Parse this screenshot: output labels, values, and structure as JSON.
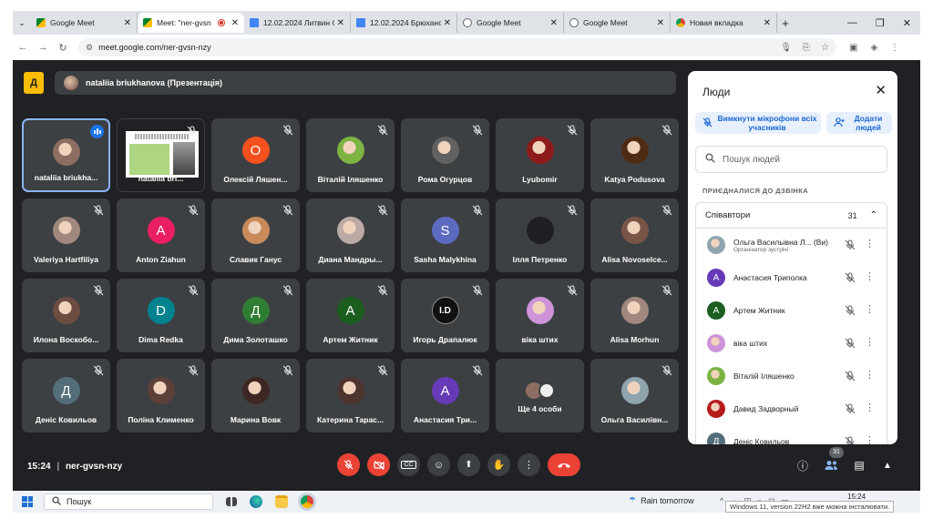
{
  "browser": {
    "tabs": [
      {
        "title": "Google Meet",
        "active": false,
        "icon": "meet-icon"
      },
      {
        "title": "Meet: \"ner-gvsn",
        "active": true,
        "icon": "meet-icon",
        "recording": true
      },
      {
        "title": "12.02.2024 Литвин С",
        "active": false,
        "icon": "docs-icon"
      },
      {
        "title": "12.02.2024 Брюханс",
        "active": false,
        "icon": "docs-icon"
      },
      {
        "title": "Google Meet",
        "active": false,
        "icon": "globe-icon"
      },
      {
        "title": "Google Meet",
        "active": false,
        "icon": "globe-icon"
      },
      {
        "title": "Новая вкладка",
        "active": false,
        "icon": "chrome-icon"
      }
    ],
    "url": "meet.google.com/ner-gvsn-nzy"
  },
  "meet": {
    "presenter_badge": "Д",
    "presenting_label": "nataliia briukhanova (Презентація)",
    "tiles": [
      {
        "name": "nataliia briukha...",
        "kind": "photo",
        "color": "#8d6e63",
        "speaking": true
      },
      {
        "name": "nataliia bri...",
        "kind": "slide"
      },
      {
        "name": "Олексій Ляшен...",
        "kind": "letter",
        "letter": "О",
        "color": "#f4511e"
      },
      {
        "name": "Віталій Іляшенко",
        "kind": "photo",
        "color": "#7cb342"
      },
      {
        "name": "Рома Огурцов",
        "kind": "photo",
        "color": "#616161"
      },
      {
        "name": "Lyubomir",
        "kind": "photo",
        "color": "#8e1b1b"
      },
      {
        "name": "Katya Podusova",
        "kind": "photo",
        "color": "#4e2c14"
      },
      {
        "name": "Valeriya Hartfiliya",
        "kind": "photo",
        "color": "#a1887f"
      },
      {
        "name": "Anton Ziahun",
        "kind": "letter",
        "letter": "A",
        "color": "#e91e63"
      },
      {
        "name": "Славик Ганус",
        "kind": "photo",
        "color": "#c98a5a"
      },
      {
        "name": "Диана Мандры...",
        "kind": "photo",
        "color": "#bcaaa4"
      },
      {
        "name": "Sasha Malykhina",
        "kind": "letter",
        "letter": "S",
        "color": "#5c6bc0"
      },
      {
        "name": "Ілля Петренко",
        "kind": "letter",
        "letter": "",
        "color": "#1e1f22"
      },
      {
        "name": "Alisa Novoselce...",
        "kind": "photo",
        "color": "#795548"
      },
      {
        "name": "Илона Воскобо...",
        "kind": "photo",
        "color": "#6d4c41"
      },
      {
        "name": "Dima Redka",
        "kind": "letter",
        "letter": "D",
        "color": "#00838f"
      },
      {
        "name": "Дима Золоташко",
        "kind": "letter",
        "letter": "Д",
        "color": "#2e7d32"
      },
      {
        "name": "Артем Житник",
        "kind": "letter",
        "letter": "A",
        "color": "#1b5e20"
      },
      {
        "name": "Игорь Драпалюк",
        "kind": "letter",
        "letter": "I.D",
        "color": "#111111"
      },
      {
        "name": "віка штих",
        "kind": "photo",
        "color": "#ce93d8"
      },
      {
        "name": "Alisa Morhun",
        "kind": "photo",
        "color": "#a1887f"
      },
      {
        "name": "Деніс Ковильов",
        "kind": "letter",
        "letter": "Д",
        "color": "#546e7a"
      },
      {
        "name": "Поліна Клименко",
        "kind": "photo",
        "color": "#5d4037"
      },
      {
        "name": "Марина Вовк",
        "kind": "photo",
        "color": "#3e2723"
      },
      {
        "name": "Катерина Тарас...",
        "kind": "photo",
        "color": "#4e342e"
      },
      {
        "name": "Анастасия Три...",
        "kind": "letter",
        "letter": "A",
        "color": "#673ab7"
      },
      {
        "name": "Ще 4 особи",
        "kind": "group"
      },
      {
        "name": "Ольга Василівн...",
        "kind": "photo",
        "color": "#90a4ae"
      }
    ],
    "time": "15:24",
    "meeting_code": "ner-gvsn-nzy",
    "people_count": "31"
  },
  "panel": {
    "title": "Люди",
    "mute_all_label": "Вимкнути мікрофони всіх учасників",
    "add_people_label": "Додати людей",
    "search_placeholder": "Пошук людей",
    "section_label": "ПРИЄДНАЛИСЯ ДО ДЗВІНКА",
    "group_label": "Співавтори",
    "group_count": "31",
    "participants": [
      {
        "name": "Ольга Васильівна Л... (Ви)",
        "sub": "Організатор зустрічі",
        "color": "#90a4ae",
        "letter": ""
      },
      {
        "name": "Анастасия Триполка",
        "sub": "",
        "color": "#673ab7",
        "letter": "A"
      },
      {
        "name": "Артем Житник",
        "sub": "",
        "color": "#1b5e20",
        "letter": "A"
      },
      {
        "name": "віка штих",
        "sub": "",
        "color": "#ce93d8",
        "letter": ""
      },
      {
        "name": "Віталій Іляшенко",
        "sub": "",
        "color": "#7cb342",
        "letter": ""
      },
      {
        "name": "Давид Задворный",
        "sub": "",
        "color": "#b71c1c",
        "letter": ""
      },
      {
        "name": "Деніс Ковильов",
        "sub": "",
        "color": "#546e7a",
        "letter": "Д"
      }
    ]
  },
  "taskbar": {
    "search_label": "Пошук",
    "weather": "Rain tomorrow",
    "time": "15:24",
    "notice": "Windows 11, version 22H2 вже можна інсталювати."
  }
}
